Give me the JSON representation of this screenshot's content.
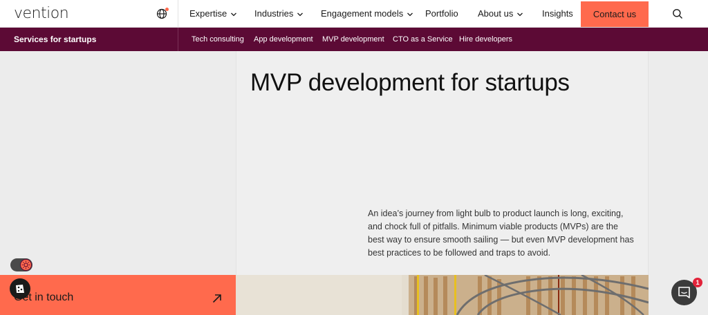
{
  "header": {
    "logo": "vention",
    "nav": [
      {
        "label": "Expertise",
        "dropdown": true
      },
      {
        "label": "Industries",
        "dropdown": true
      },
      {
        "label": "Engagement models",
        "dropdown": true
      },
      {
        "label": "Portfolio",
        "dropdown": false
      },
      {
        "label": "About us",
        "dropdown": true
      },
      {
        "label": "Insights",
        "dropdown": false
      }
    ],
    "contact_label": "Contact us",
    "language_icon": "globe-icon",
    "search_icon": "search-icon"
  },
  "subnav": {
    "title": "Services for startups",
    "links": [
      "Tech consulting",
      "App development",
      "MVP development",
      "CTO as a Service",
      "Hire developers"
    ]
  },
  "hero": {
    "title": "MVP development for startups",
    "description": "An idea’s journey from light bulb to product launch is long, exciting, and chock full of pitfalls. Minimum viable products (MVPs) are the best way to ensure smooth sailing — but even MVP development has best practices to be followed and traps to avoid."
  },
  "cta": {
    "label": "Get in touch",
    "icon": "arrow-up-right-icon"
  },
  "chat": {
    "badge_count": "1",
    "icon": "chat-icon"
  },
  "colors": {
    "accent": "#ff6a4d",
    "brand_dark": "#5c0a35",
    "background": "#ececec"
  }
}
